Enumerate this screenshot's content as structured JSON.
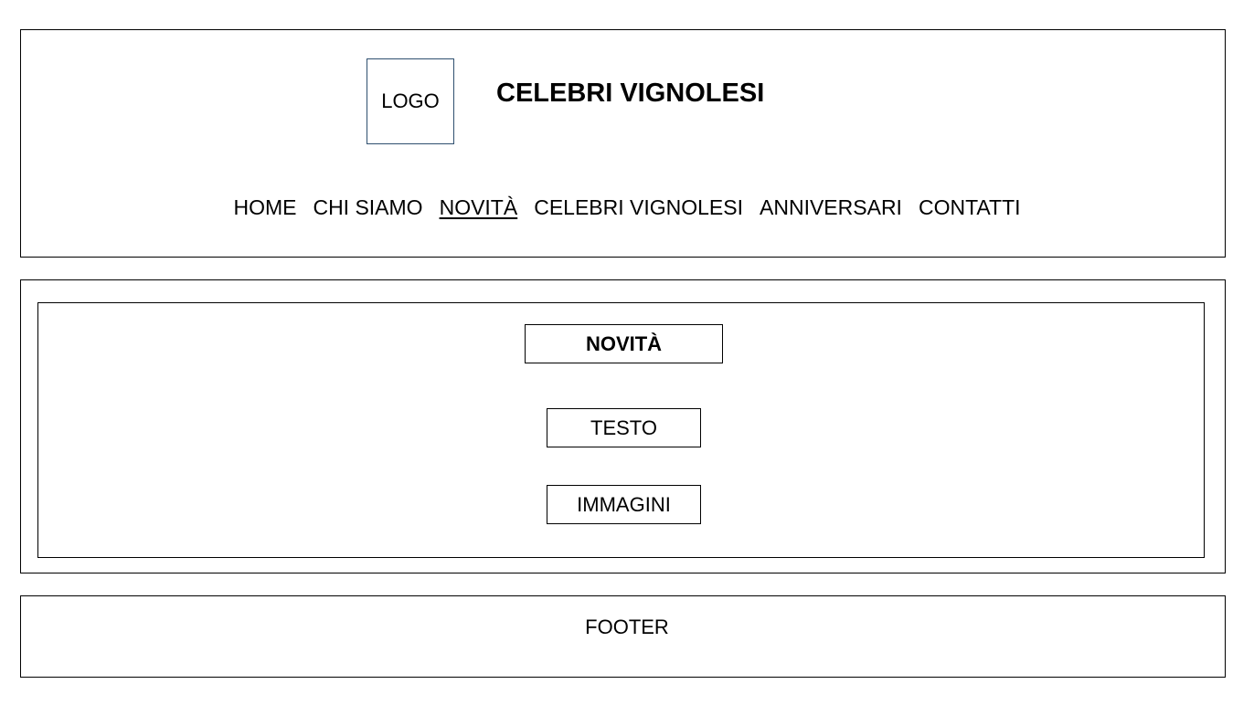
{
  "header": {
    "logo_label": "LOGO",
    "site_title": "CELEBRI VIGNOLESI",
    "nav": [
      {
        "label": "HOME",
        "active": false
      },
      {
        "label": "CHI SIAMO",
        "active": false
      },
      {
        "label": "NOVITÀ",
        "active": true
      },
      {
        "label": "CELEBRI VIGNOLESI",
        "active": false
      },
      {
        "label": "ANNIVERSARI",
        "active": false
      },
      {
        "label": "CONTATTI",
        "active": false
      }
    ]
  },
  "main": {
    "section_title": "NOVITÀ",
    "text_block": "TESTO",
    "images_block": "IMMAGINI"
  },
  "footer": {
    "label": "FOOTER"
  }
}
